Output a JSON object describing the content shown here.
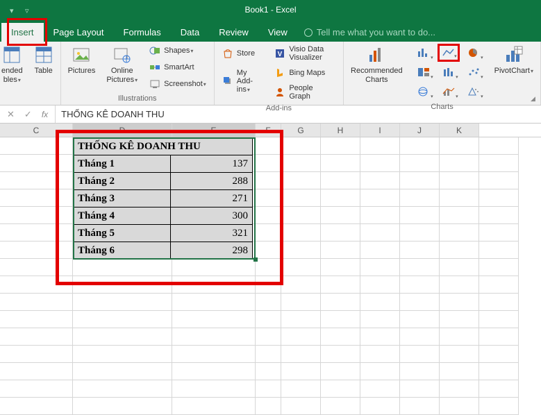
{
  "app": {
    "title": "Book1 - Excel"
  },
  "tabs": {
    "insert": "Insert",
    "page_layout": "Page Layout",
    "formulas": "Formulas",
    "data": "Data",
    "review": "Review",
    "view": "View",
    "tell_me": "Tell me what you want to do..."
  },
  "ribbon": {
    "tables": {
      "recommended": "ended\nbles",
      "table": "Table"
    },
    "illustrations": {
      "label": "Illustrations",
      "pictures": "Pictures",
      "online_pictures": "Online\nPictures",
      "shapes": "Shapes",
      "smartart": "SmartArt",
      "screenshot": "Screenshot"
    },
    "addins": {
      "label": "Add-ins",
      "store": "Store",
      "my_addins": "My Add-ins",
      "visio": "Visio Data Visualizer",
      "bing": "Bing Maps",
      "people": "People Graph"
    },
    "charts": {
      "label": "Charts",
      "recommended": "Recommended\nCharts",
      "pivotchart": "PivotChart"
    }
  },
  "formula_bar": {
    "value": "THỐNG KÊ DOANH THU"
  },
  "columns": [
    "C",
    "D",
    "E",
    "F",
    "G",
    "H",
    "I",
    "J",
    "K"
  ],
  "table": {
    "title": "THỐNG KÊ DOANH THU",
    "rows": [
      {
        "label": "Tháng 1",
        "value": "137"
      },
      {
        "label": "Tháng 2",
        "value": "288"
      },
      {
        "label": "Tháng 3",
        "value": "271"
      },
      {
        "label": "Tháng 4",
        "value": "300"
      },
      {
        "label": "Tháng 5",
        "value": "321"
      },
      {
        "label": "Tháng 6",
        "value": "298"
      }
    ]
  },
  "colors": {
    "excel_green": "#217346",
    "highlight_red": "#e30000"
  }
}
